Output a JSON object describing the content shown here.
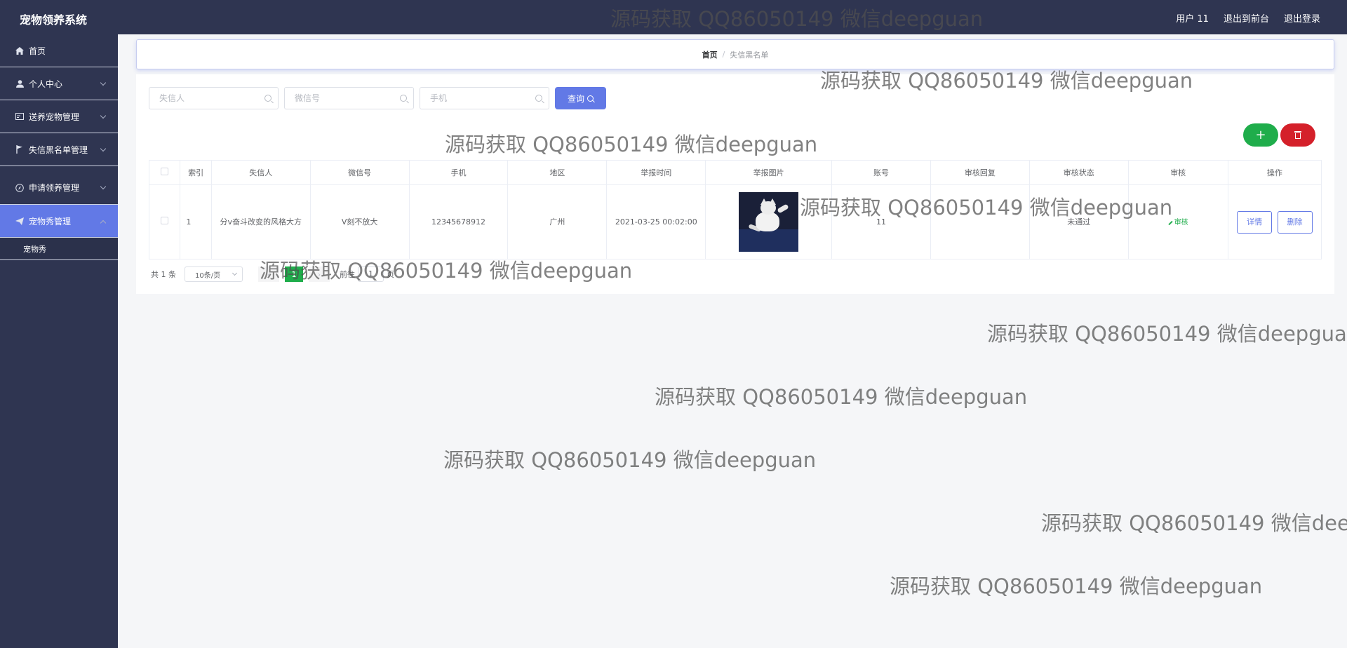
{
  "header": {
    "brand": "宠物领养系统",
    "user": "用户 11",
    "back_front": "退出到前台",
    "logout": "退出登录"
  },
  "sidebar": {
    "items": [
      {
        "label": "首页",
        "icon": "home-icon"
      },
      {
        "label": "个人中心",
        "icon": "user-icon"
      },
      {
        "label": "送养宠物管理",
        "icon": "card-icon"
      },
      {
        "label": "失信黑名单管理",
        "icon": "flag-icon"
      },
      {
        "label": "申请领养管理",
        "icon": "compass-icon"
      },
      {
        "label": "宠物秀管理",
        "icon": "paper-plane-icon"
      }
    ],
    "submenu_item": "宠物秀"
  },
  "breadcrumb": {
    "home": "首页",
    "separator": "/",
    "current": "失信黑名单"
  },
  "search": {
    "name_placeholder": "失信人",
    "wechat_placeholder": "微信号",
    "phone_placeholder": "手机",
    "query_label": "查询"
  },
  "actions": {
    "add_symbol": "+"
  },
  "table": {
    "headers": [
      "索引",
      "失信人",
      "微信号",
      "手机",
      "地区",
      "举报时间",
      "举报图片",
      "账号",
      "审核回复",
      "审核状态",
      "审核",
      "操作"
    ],
    "rows": [
      {
        "index": "1",
        "name": "分v奋斗改变的风格大方",
        "wechat": "V刻不放大",
        "phone": "12345678912",
        "region": "广州",
        "report_time": "2021-03-25 00:02:00",
        "account": "11",
        "reply": "",
        "status": "未通过",
        "audit": "审核",
        "detail": "详情",
        "delete": "删除"
      }
    ]
  },
  "pagination": {
    "total": "共 1 条",
    "page_size": "10条/页",
    "current_page": "1",
    "goto": "前往",
    "goto_value": "1",
    "page_unit": "页"
  },
  "watermark": "源码获取 QQ86050149 微信deepguan",
  "colors": {
    "sidebar_bg": "#2f3551",
    "accent": "#6279e6",
    "success": "#1fad4b",
    "danger": "#d4202a"
  }
}
